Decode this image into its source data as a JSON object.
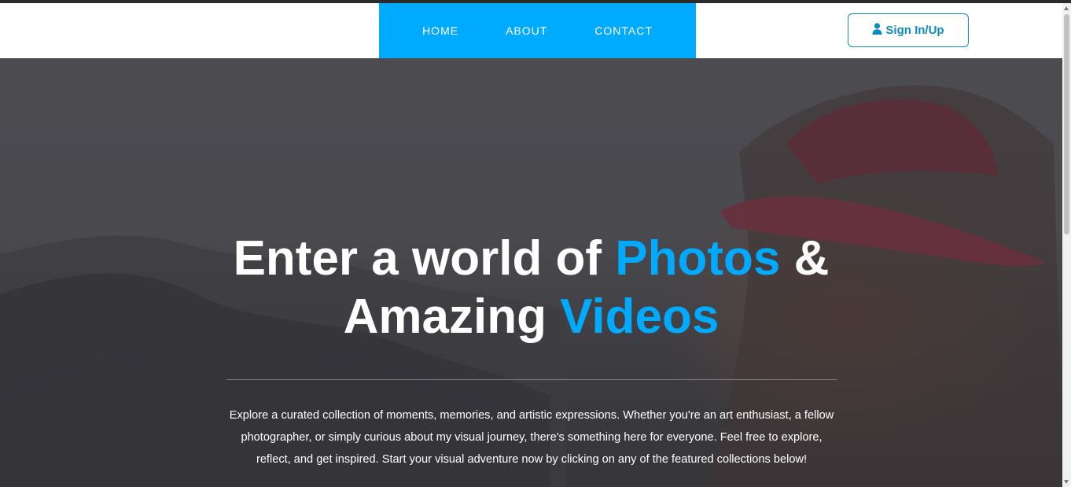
{
  "nav": {
    "items": [
      {
        "label": "HOME"
      },
      {
        "label": "ABOUT"
      },
      {
        "label": "CONTACT"
      }
    ],
    "signin_label": "Sign In/Up",
    "signin_icon": "user-icon"
  },
  "hero": {
    "title_part1": "Enter a world of ",
    "title_accent1": "Photos",
    "title_part2": " &",
    "title_part3": "Amazing ",
    "title_accent2": "Videos",
    "description": "Explore a curated collection of moments, memories, and artistic expressions. Whether you're an art enthusiast, a fellow photographer, or simply curious about my visual journey, there's something here for everyone. Feel free to explore, reflect, and get inspired. Start your visual adventure now by clicking on any of the featured collections below!"
  },
  "colors": {
    "accent": "#00aaff",
    "signin_border": "#0d8bbd",
    "hero_overlay": "#4a4a4f"
  }
}
